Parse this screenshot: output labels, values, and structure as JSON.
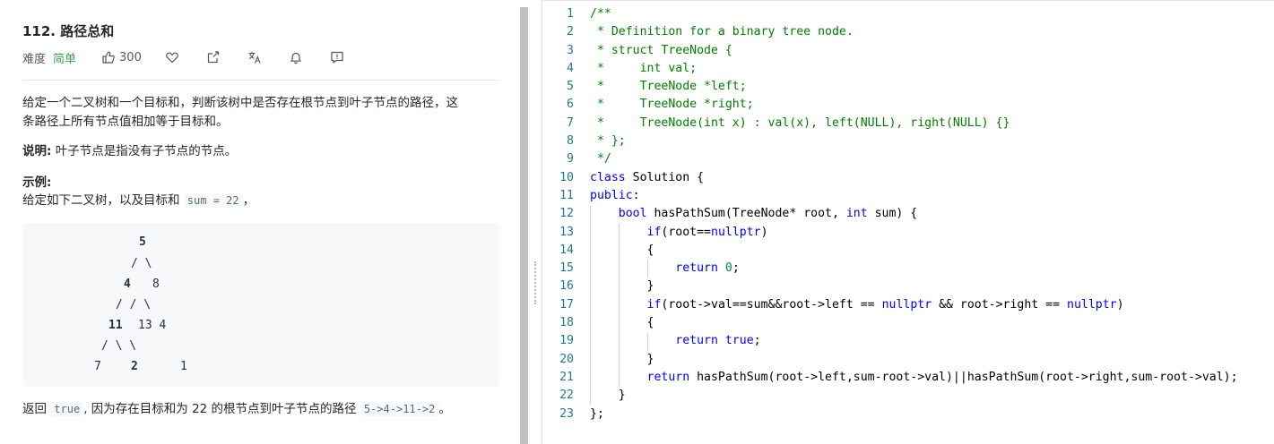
{
  "problem": {
    "title": "112. 路径总和",
    "difficulty_label": "难度",
    "difficulty": "简单",
    "likes": "300",
    "desc_1": "给定一个二叉树和一个目标和，判断该树中是否存在根节点到叶子节点的路径，这",
    "desc_2": "条路径上所有节点值相加等于目标和。",
    "note_label": "说明:",
    "note_text": " 叶子节点是指没有子节点的节点。",
    "example_label": "示例:",
    "example_intro": "给定如下二叉树，以及目标和 ",
    "example_code": "sum = 22",
    "example_tail": "，",
    "tree": {
      "r1": "5",
      "r2": "/ \\",
      "r3a": "4",
      "r3b": "8",
      "r4": "/   / \\",
      "r5a": "11",
      "r5b": "13  4",
      "r6": "/  \\      \\",
      "r7a": "7",
      "r7b": "2",
      "r7c": "1"
    },
    "answer_pre": "返回 ",
    "answer_code": "true",
    "answer_mid": ", 因为存在目标和为 22 的根节点到叶子节点的路径 ",
    "answer_path": "5->4->11->2",
    "answer_end": "。"
  },
  "toolbar_icons": [
    "thumb-up-icon",
    "heart-icon",
    "share-icon",
    "translate-icon",
    "bell-icon",
    "feedback-icon"
  ],
  "colors": {
    "easy": "#43a047",
    "comment": "#008000",
    "keyword": "#0000ff",
    "number": "#098658",
    "line_number": "#237893"
  },
  "code": {
    "lines": [
      {
        "n": "1",
        "parts": [
          {
            "t": "/**",
            "c": "cm"
          }
        ]
      },
      {
        "n": "2",
        "parts": [
          {
            "t": " * Definition for a binary tree node.",
            "c": "cm"
          }
        ]
      },
      {
        "n": "3",
        "parts": [
          {
            "t": " * struct TreeNode {",
            "c": "cm"
          }
        ]
      },
      {
        "n": "4",
        "parts": [
          {
            "t": " *     int val;",
            "c": "cm"
          }
        ]
      },
      {
        "n": "5",
        "parts": [
          {
            "t": " *     TreeNode *left;",
            "c": "cm"
          }
        ]
      },
      {
        "n": "6",
        "parts": [
          {
            "t": " *     TreeNode *right;",
            "c": "cm"
          }
        ]
      },
      {
        "n": "7",
        "parts": [
          {
            "t": " *     TreeNode(int x) : val(x), left(NULL), right(NULL) {}",
            "c": "cm"
          }
        ]
      },
      {
        "n": "8",
        "parts": [
          {
            "t": " * };",
            "c": "cm"
          }
        ]
      },
      {
        "n": "9",
        "parts": [
          {
            "t": " */",
            "c": "cm"
          }
        ]
      },
      {
        "n": "10",
        "parts": [
          {
            "t": "class",
            "c": "kw"
          },
          {
            "t": " Solution {",
            "c": ""
          }
        ]
      },
      {
        "n": "11",
        "parts": [
          {
            "t": "public",
            "c": "kw"
          },
          {
            "t": ":",
            "c": ""
          }
        ]
      },
      {
        "n": "12",
        "parts": [
          {
            "t": "    ",
            "c": ""
          },
          {
            "t": "bool",
            "c": "kw"
          },
          {
            "t": " hasPathSum(TreeNode* root, ",
            "c": ""
          },
          {
            "t": "int",
            "c": "kw"
          },
          {
            "t": " sum) {",
            "c": ""
          }
        ]
      },
      {
        "n": "13",
        "parts": [
          {
            "t": "        ",
            "c": ""
          },
          {
            "t": "if",
            "c": "kw"
          },
          {
            "t": "(root==",
            "c": ""
          },
          {
            "t": "nullptr",
            "c": "kw"
          },
          {
            "t": ")",
            "c": ""
          }
        ]
      },
      {
        "n": "14",
        "parts": [
          {
            "t": "        {",
            "c": ""
          }
        ]
      },
      {
        "n": "15",
        "parts": [
          {
            "t": "            ",
            "c": ""
          },
          {
            "t": "return",
            "c": "kw"
          },
          {
            "t": " ",
            "c": ""
          },
          {
            "t": "0",
            "c": "num"
          },
          {
            "t": ";",
            "c": ""
          }
        ]
      },
      {
        "n": "16",
        "parts": [
          {
            "t": "        }",
            "c": ""
          }
        ]
      },
      {
        "n": "17",
        "parts": [
          {
            "t": "        ",
            "c": ""
          },
          {
            "t": "if",
            "c": "kw"
          },
          {
            "t": "(root->val==sum&&root->left == ",
            "c": ""
          },
          {
            "t": "nullptr",
            "c": "kw"
          },
          {
            "t": " && root->right == ",
            "c": ""
          },
          {
            "t": "nullptr",
            "c": "kw"
          },
          {
            "t": ")",
            "c": ""
          }
        ]
      },
      {
        "n": "18",
        "parts": [
          {
            "t": "        {",
            "c": ""
          }
        ]
      },
      {
        "n": "19",
        "parts": [
          {
            "t": "            ",
            "c": ""
          },
          {
            "t": "return",
            "c": "kw"
          },
          {
            "t": " ",
            "c": ""
          },
          {
            "t": "true",
            "c": "kw"
          },
          {
            "t": ";",
            "c": ""
          }
        ]
      },
      {
        "n": "20",
        "parts": [
          {
            "t": "        }",
            "c": ""
          }
        ]
      },
      {
        "n": "21",
        "parts": [
          {
            "t": "        ",
            "c": ""
          },
          {
            "t": "return",
            "c": "kw"
          },
          {
            "t": " hasPathSum(root->left,sum-root->val)||hasPathSum(root->right,sum-root->val);",
            "c": ""
          }
        ]
      },
      {
        "n": "22",
        "parts": [
          {
            "t": "    }",
            "c": ""
          }
        ]
      },
      {
        "n": "23",
        "parts": [
          {
            "t": "};",
            "c": ""
          }
        ]
      }
    ]
  }
}
